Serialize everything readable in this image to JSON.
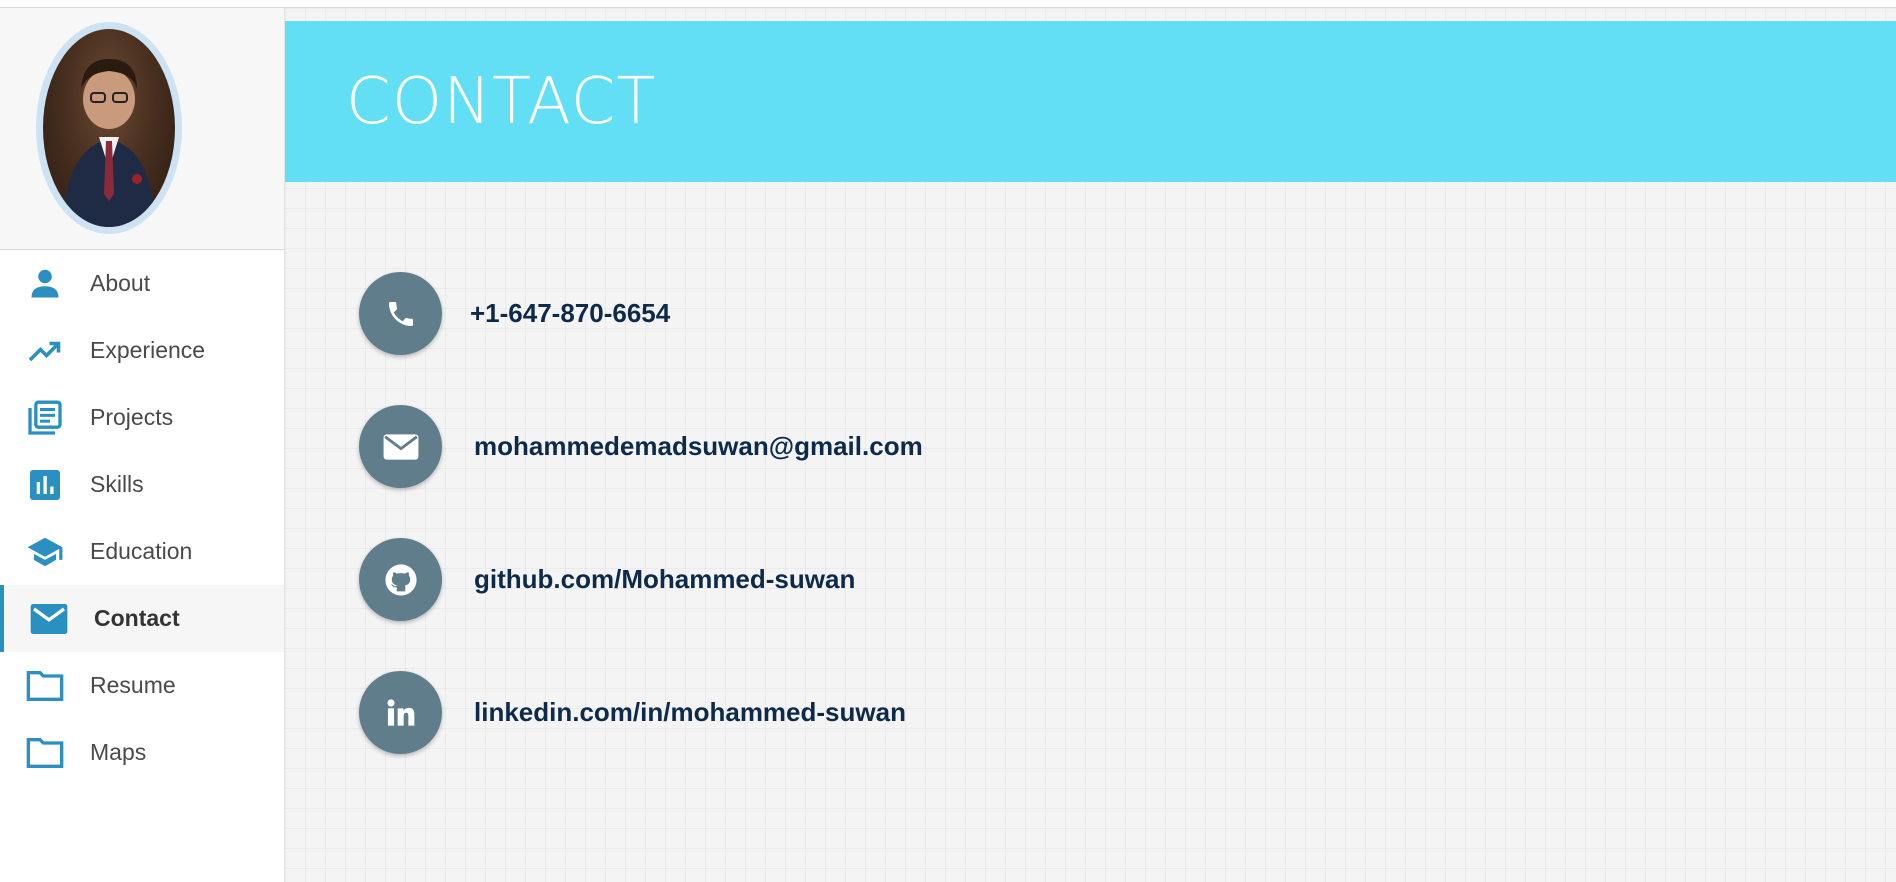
{
  "header": {
    "title": "CONTACT"
  },
  "sidebar": {
    "items": [
      {
        "label": "About",
        "icon": "person-icon"
      },
      {
        "label": "Experience",
        "icon": "trending-up-icon"
      },
      {
        "label": "Projects",
        "icon": "library-books-icon"
      },
      {
        "label": "Skills",
        "icon": "bar-chart-icon"
      },
      {
        "label": "Education",
        "icon": "graduation-cap-icon"
      },
      {
        "label": "Contact",
        "icon": "mail-icon",
        "active": true
      },
      {
        "label": "Resume",
        "icon": "folder-icon"
      },
      {
        "label": "Maps",
        "icon": "folder-icon"
      }
    ]
  },
  "contacts": [
    {
      "icon": "phone-icon",
      "text": "+1-647-870-6654"
    },
    {
      "icon": "envelope-icon",
      "text": "mohammedemadsuwan@gmail.com"
    },
    {
      "icon": "github-icon",
      "text": "github.com/Mohammed-suwan"
    },
    {
      "icon": "linkedin-icon",
      "text": "linkedin.com/in/mohammed-suwan"
    }
  ],
  "colors": {
    "accent": "#2a8fc1",
    "header_bg": "#62dff4",
    "icon_circle": "#607d8b",
    "contact_text": "#0d2a4a"
  }
}
